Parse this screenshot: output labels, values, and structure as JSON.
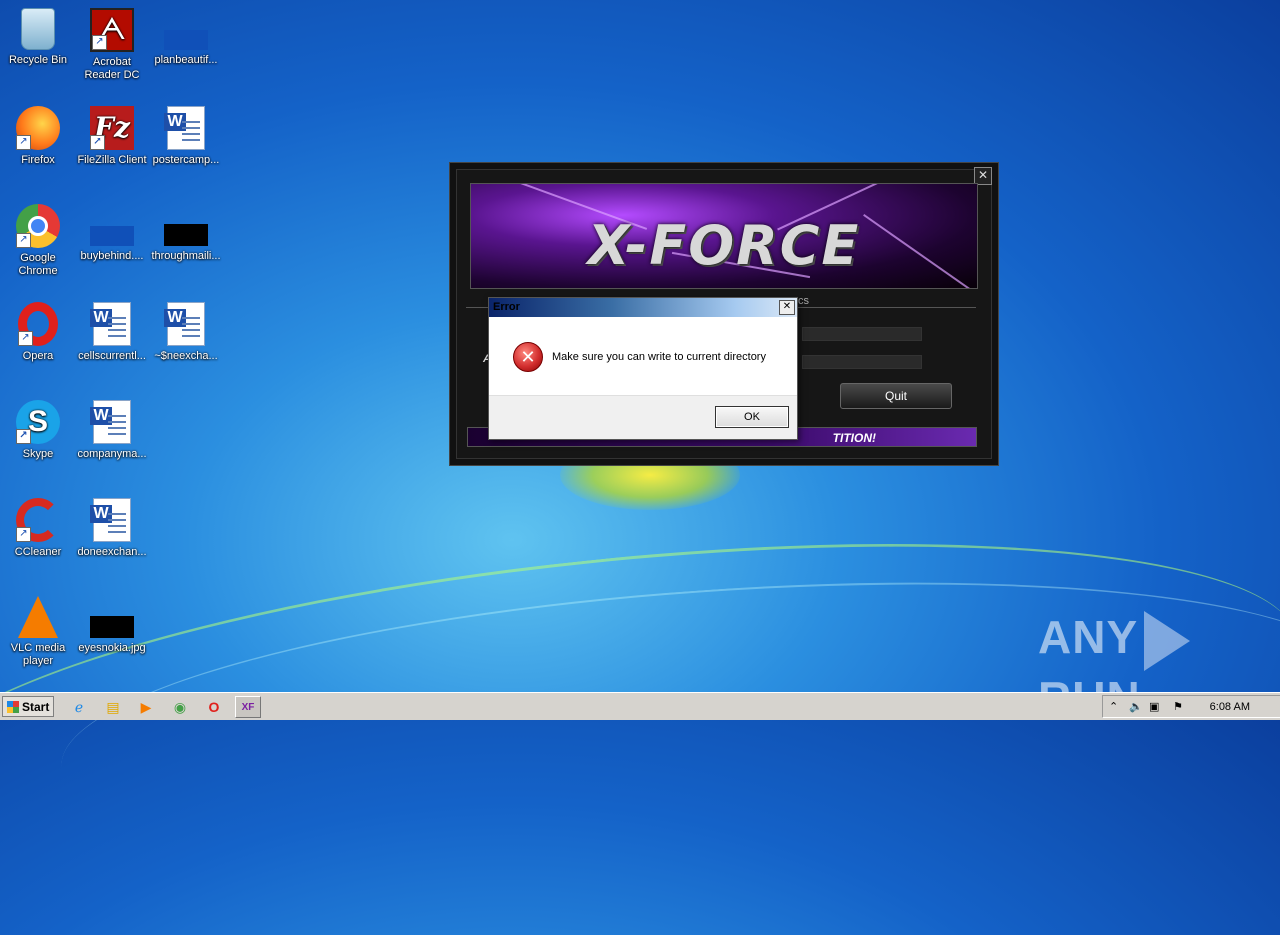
{
  "desktop": {
    "icons": [
      {
        "label": "Recycle Bin"
      },
      {
        "label": "Acrobat Reader DC"
      },
      {
        "label": "planbeautif..."
      },
      {
        "label": "Firefox"
      },
      {
        "label": "FileZilla Client"
      },
      {
        "label": "postercamp..."
      },
      {
        "label": "Google Chrome"
      },
      {
        "label": "buybehind...."
      },
      {
        "label": "throughmaili..."
      },
      {
        "label": "Opera"
      },
      {
        "label": "cellscurrentl..."
      },
      {
        "label": "~$neexcha..."
      },
      {
        "label": "Skype"
      },
      {
        "label": "companyma..."
      },
      {
        "label": "CCleaner"
      },
      {
        "label": "doneexchan..."
      },
      {
        "label": "VLC media player"
      },
      {
        "label": "eyesnokia.jpg"
      }
    ]
  },
  "xforce": {
    "banner_text": "X-FORCE",
    "quit_label": "Quit",
    "footer_text": "TITION!",
    "close_glyph": "✕",
    "tab_text": "cs",
    "field_label": "A"
  },
  "error_dialog": {
    "title": "Error",
    "message": "Make sure you can write to current directory",
    "ok_label": "OK",
    "close_glyph": "✕"
  },
  "watermark": {
    "left": "ANY",
    "right": "RUN"
  },
  "taskbar": {
    "start_label": "Start",
    "clock": "6:08 AM"
  },
  "colors": {
    "desktop_blue": "#1462c8",
    "xforce_purple": "#5a1590",
    "error_red": "#d32f2f"
  }
}
